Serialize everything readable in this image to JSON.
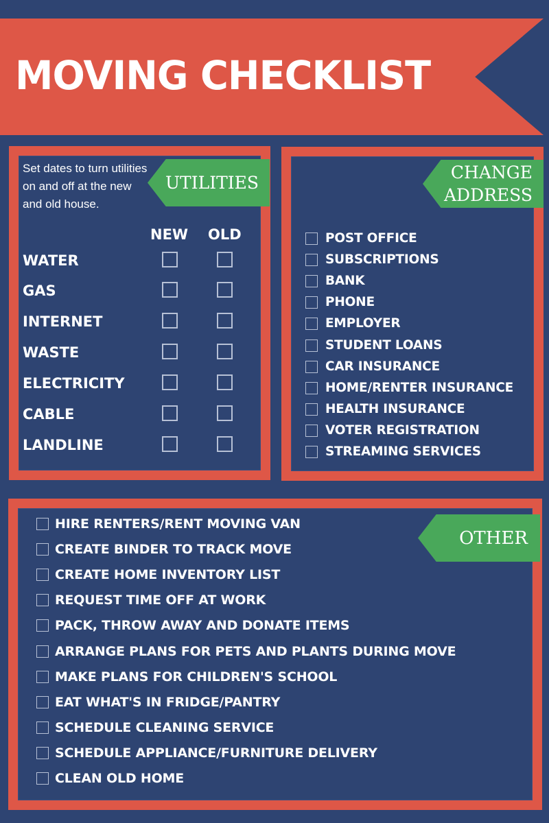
{
  "title": "MOVING CHECKLIST",
  "colors": {
    "background": "#2E4472",
    "accent": "#DE5747",
    "tag": "#49A85A",
    "text": "#FFFFFF",
    "checkbox_border": "#B7C1D6"
  },
  "utilities": {
    "tag": "UTILITIES",
    "description": "Set dates to turn utilities on and off at the new and old house.",
    "columns": [
      "NEW",
      "OLD"
    ],
    "rows": [
      {
        "label": "WATER",
        "new": false,
        "old": false
      },
      {
        "label": "GAS",
        "new": false,
        "old": false
      },
      {
        "label": "INTERNET",
        "new": false,
        "old": false
      },
      {
        "label": "WASTE",
        "new": false,
        "old": false
      },
      {
        "label": "ELECTRICITY",
        "new": false,
        "old": false
      },
      {
        "label": "CABLE",
        "new": false,
        "old": false
      },
      {
        "label": "LANDLINE",
        "new": false,
        "old": false
      }
    ]
  },
  "change_address": {
    "tag_line1": "CHANGE",
    "tag_line2": "ADDRESS",
    "items": [
      {
        "label": "POST OFFICE",
        "checked": false
      },
      {
        "label": "SUBSCRIPTIONS",
        "checked": false
      },
      {
        "label": "BANK",
        "checked": false
      },
      {
        "label": "PHONE",
        "checked": false
      },
      {
        "label": "EMPLOYER",
        "checked": false
      },
      {
        "label": "STUDENT LOANS",
        "checked": false
      },
      {
        "label": "CAR INSURANCE",
        "checked": false
      },
      {
        "label": "HOME/RENTER INSURANCE",
        "checked": false
      },
      {
        "label": "HEALTH INSURANCE",
        "checked": false
      },
      {
        "label": "VOTER REGISTRATION",
        "checked": false
      },
      {
        "label": "STREAMING SERVICES",
        "checked": false
      }
    ]
  },
  "other": {
    "tag": "OTHER",
    "items": [
      {
        "label": "HIRE RENTERS/RENT MOVING VAN",
        "checked": false
      },
      {
        "label": "CREATE BINDER TO TRACK MOVE",
        "checked": false
      },
      {
        "label": "CREATE HOME INVENTORY LIST",
        "checked": false
      },
      {
        "label": "REQUEST TIME OFF AT WORK",
        "checked": false
      },
      {
        "label": "PACK, THROW AWAY AND DONATE ITEMS",
        "checked": false
      },
      {
        "label": "ARRANGE PLANS FOR PETS AND PLANTS DURING MOVE",
        "checked": false
      },
      {
        "label": "MAKE PLANS FOR CHILDREN'S SCHOOL",
        "checked": false
      },
      {
        "label": "EAT WHAT'S IN FRIDGE/PANTRY",
        "checked": false
      },
      {
        "label": "SCHEDULE CLEANING SERVICE",
        "checked": false
      },
      {
        "label": "SCHEDULE APPLIANCE/FURNITURE DELIVERY",
        "checked": false
      },
      {
        "label": "CLEAN OLD HOME",
        "checked": false
      }
    ]
  }
}
